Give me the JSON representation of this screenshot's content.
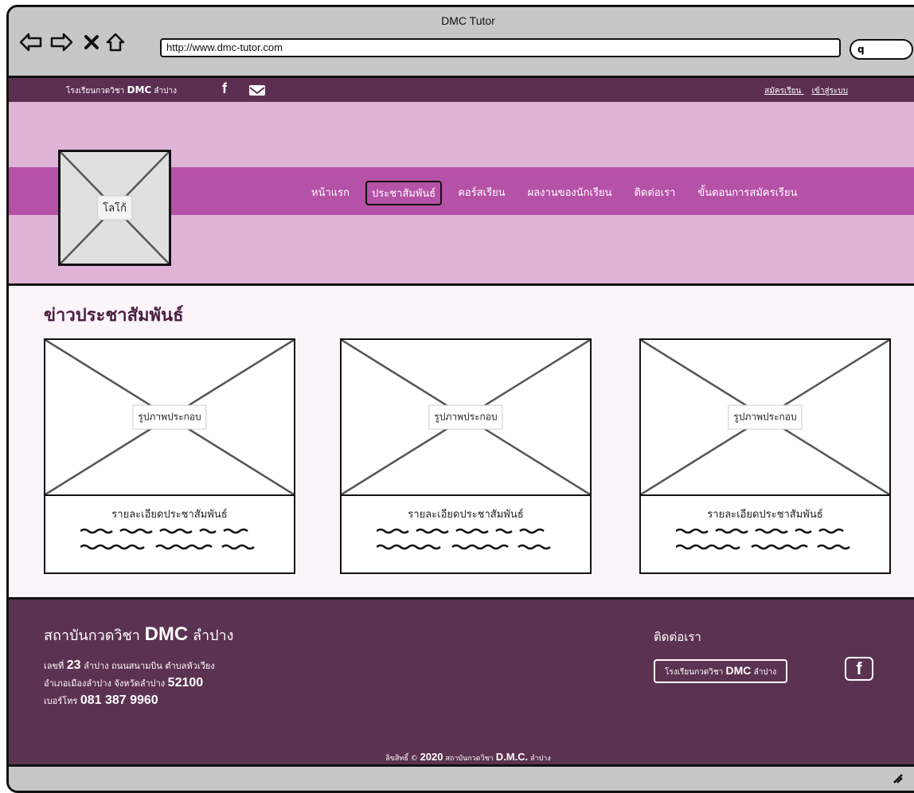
{
  "window": {
    "title": "DMC Tutor",
    "url": "http://www.dmc-tutor.com"
  },
  "topbar": {
    "brand_prefix": "โรงเรียนกวดวิชา",
    "brand_name": "DMC",
    "brand_suffix": "ลำปาง",
    "register_link": "สมัครเรียน",
    "login_link": "เข้าสู่ระบบ"
  },
  "header": {
    "logo_label": "โลโก้",
    "menu": [
      {
        "label": "หน้าแรก",
        "active": false
      },
      {
        "label": "ประชาสัมพันธ์",
        "active": true
      },
      {
        "label": "คอร์สเรียน",
        "active": false
      },
      {
        "label": "ผลงานของนักเรียน",
        "active": false
      },
      {
        "label": "ติดต่อเรา",
        "active": false
      },
      {
        "label": "ขั้นตอนการสมัครเรียน",
        "active": false
      }
    ]
  },
  "news": {
    "heading": "ข่าวประชาสัมพันธ์",
    "cards": [
      {
        "image_label": "รูปภาพประกอบ",
        "detail": "รายละเอียดประชาสัมพันธ์"
      },
      {
        "image_label": "รูปภาพประกอบ",
        "detail": "รายละเอียดประชาสัมพันธ์"
      },
      {
        "image_label": "รูปภาพประกอบ",
        "detail": "รายละเอียดประชาสัมพันธ์"
      }
    ]
  },
  "footer": {
    "org_prefix": "สถาบันกวดวิชา",
    "org_name": "DMC",
    "org_suffix": "ลำปาง",
    "addr1_a": "เลขที่",
    "addr1_num": "23",
    "addr1_b": "ลำปาง ถนนสนามบิน ตำบลหัวเวียง",
    "addr2_a": "อำเภอเมืองลำปาง จังหวัดลำปาง",
    "addr2_zip": "52100",
    "phone_label": "เบอร์โทร",
    "phone": "081 387 9960",
    "contact_heading": "ติดต่อเรา",
    "fb_prefix": "โรงเรียนกวดวิชา",
    "fb_name": "DMC",
    "fb_suffix": "ลำปาง",
    "copy_prefix": "ลิขสิทธิ์ ©",
    "copy_year": "2020",
    "copy_mid": "สถาบันกวดวิชา",
    "copy_name": "D.M.C.",
    "copy_suffix": "ลำปาง"
  },
  "colors": {
    "topbar": "#5c2f52",
    "banner": "#e0b4d7",
    "navband": "#b551a6",
    "footer": "#5c3251"
  }
}
